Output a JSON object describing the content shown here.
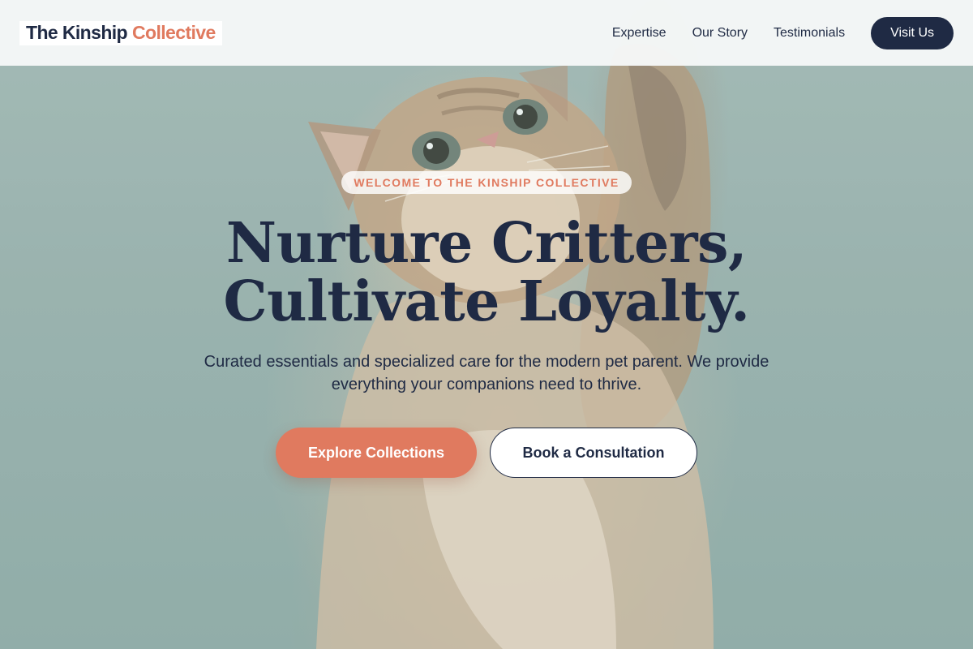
{
  "header": {
    "logo_main": "The Kinship",
    "logo_accent": "Collective",
    "nav": [
      {
        "label": "Expertise"
      },
      {
        "label": "Our Story"
      },
      {
        "label": "Testimonials"
      }
    ],
    "cta_label": "Visit Us"
  },
  "hero": {
    "eyebrow": "Welcome to The Kinship Collective",
    "headline_line1": "Nurture Critters,",
    "headline_line2": "Cultivate Loyalty.",
    "subtext": "Curated essentials and specialized care for the modern pet parent. We provide everything your companions need to thrive.",
    "primary_cta": "Explore Collections",
    "secondary_cta": "Book a Consultation",
    "background_image": "kitten-photo"
  },
  "colors": {
    "navy": "#1f2a44",
    "accent": "#e07a5f",
    "header_bg": "#f5f7f7",
    "hero_bg": "#8fa8a4"
  }
}
